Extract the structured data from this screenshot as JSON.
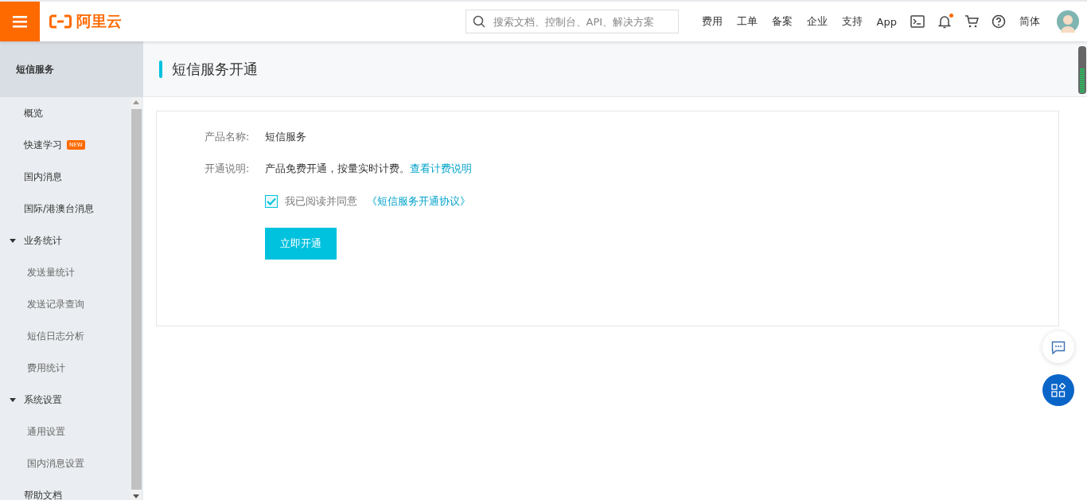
{
  "topbar": {
    "logo": "阿里云",
    "search": {
      "placeholder": "搜索文档、控制台、API、解决方案"
    },
    "links": [
      "费用",
      "工单",
      "备案",
      "企业",
      "支持",
      "App"
    ],
    "notification_dot": true,
    "language": "简体"
  },
  "sidebar": {
    "title": "短信服务",
    "items": [
      {
        "label": "概览"
      },
      {
        "label": "快速学习",
        "badge": "NEW"
      },
      {
        "label": "国内消息"
      },
      {
        "label": "国际/港澳台消息"
      },
      {
        "label": "业务统计",
        "expanded": true,
        "children": [
          {
            "label": "发送量统计"
          },
          {
            "label": "发送记录查询"
          },
          {
            "label": "短信日志分析"
          },
          {
            "label": "费用统计"
          }
        ]
      },
      {
        "label": "系统设置",
        "expanded": true,
        "children": [
          {
            "label": "通用设置"
          },
          {
            "label": "国内消息设置"
          }
        ]
      },
      {
        "label": "帮助文档"
      }
    ]
  },
  "page": {
    "title": "短信服务开通",
    "fields": [
      {
        "label": "产品名称:",
        "value": "短信服务"
      },
      {
        "label": "开通说明:",
        "value": "产品免费开通，按量实时计费。",
        "link": "查看计费说明"
      }
    ],
    "agreement": {
      "checked": true,
      "text": "我已阅读并同意",
      "link": "《短信服务开通协议》"
    },
    "button": "立即开通"
  }
}
